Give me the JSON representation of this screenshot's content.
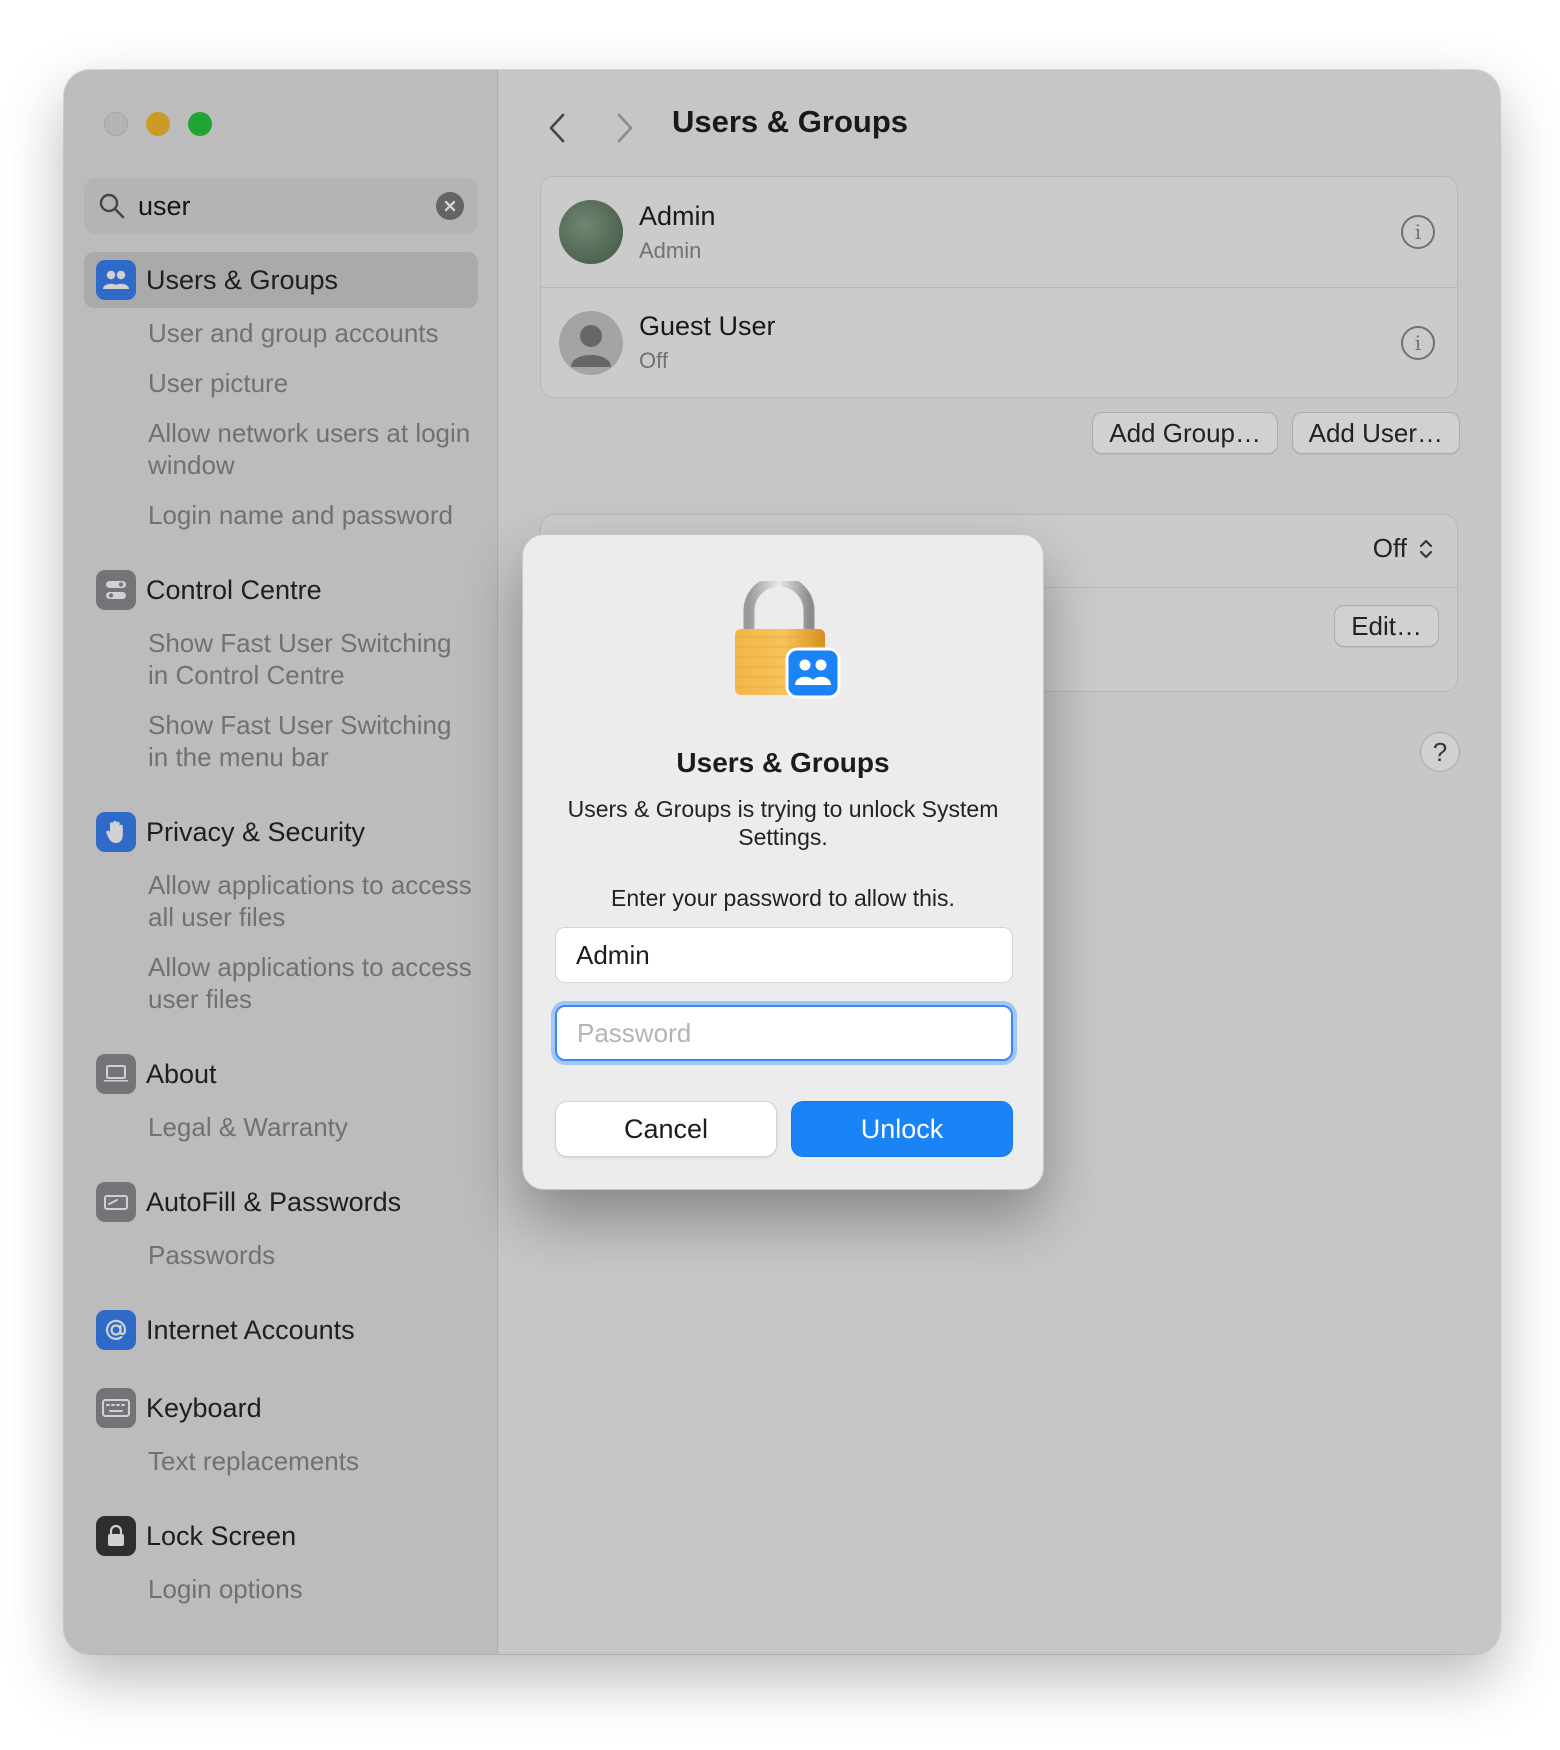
{
  "window": {
    "search": {
      "value": "user"
    },
    "sidebar": {
      "sections": [
        {
          "title": "Users & Groups",
          "icon": "users-icon",
          "selected": true,
          "items": [
            "User and group accounts",
            "User picture",
            "Allow network users at login window",
            "Login name and password"
          ]
        },
        {
          "title": "Control Centre",
          "icon": "control-centre-icon",
          "items": [
            "Show Fast User Switching in Control Centre",
            "Show Fast User Switching in the menu bar"
          ]
        },
        {
          "title": "Privacy & Security",
          "icon": "hand-icon",
          "items": [
            "Allow applications to access all user files",
            "Allow applications to access user files"
          ]
        },
        {
          "title": "About",
          "icon": "laptop-icon",
          "items": [
            "Legal & Warranty"
          ]
        },
        {
          "title": "AutoFill & Passwords",
          "icon": "autofill-icon",
          "items": [
            "Passwords"
          ]
        },
        {
          "title": "Internet Accounts",
          "icon": "at-icon",
          "items": []
        },
        {
          "title": "Keyboard",
          "icon": "keyboard-icon",
          "items": [
            "Text replacements"
          ]
        },
        {
          "title": "Lock Screen",
          "icon": "lock-icon",
          "items": [
            "Login options"
          ]
        }
      ]
    },
    "main": {
      "title": "Users & Groups",
      "users": [
        {
          "name": "Admin",
          "subtitle": "Admin"
        },
        {
          "name": "Guest User",
          "subtitle": "Off"
        }
      ],
      "add_group_label": "Add Group…",
      "add_user_label": "Add User…",
      "popup_value": "Off",
      "edit_label": "Edit…",
      "help_label": "?"
    }
  },
  "dialog": {
    "title": "Users & Groups",
    "message": "Users & Groups is trying to unlock System Settings.",
    "prompt": "Enter your password to allow this.",
    "username": "Admin",
    "password_placeholder": "Password",
    "cancel_label": "Cancel",
    "unlock_label": "Unlock"
  },
  "colors": {
    "accent": "#1a84f7",
    "sidebar_icon_blue": "#3b82f6"
  }
}
